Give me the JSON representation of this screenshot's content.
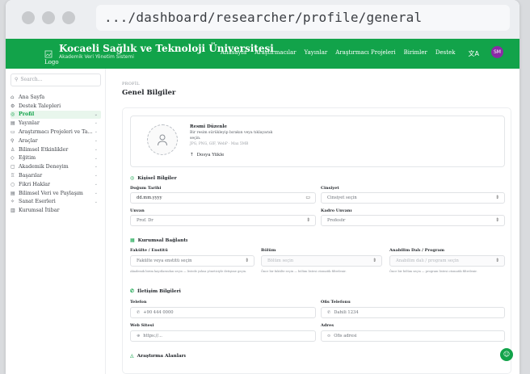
{
  "browser": {
    "url": ".../dashboard/researcher/profile/general"
  },
  "appbar": {
    "logo_alt": "Logo",
    "brand": "Kocaeli Sağlık ve Teknoloji Üniversitesi",
    "brand_sub": "Akademik Veri Yönetim Sistemi",
    "nav": [
      "Anasayfa",
      "Araştırmacılar",
      "Yayınlar",
      "Araştırmacı Projeleri",
      "Birimler",
      "Destek"
    ],
    "translate_icon": "文A",
    "avatar_initials": "SM",
    "brand_color": "#12a34a"
  },
  "sidebar": {
    "search_placeholder": "Search...",
    "items": [
      {
        "label": "Ana Sayfa",
        "icon": "⌂",
        "chevron": false,
        "active": false
      },
      {
        "label": "Destek Talepleri",
        "icon": "⚙",
        "chevron": false,
        "active": false
      },
      {
        "label": "Profil",
        "icon": "◎",
        "chevron": true,
        "active": true
      },
      {
        "label": "Yayınlar",
        "icon": "▤",
        "chevron": true,
        "active": false
      },
      {
        "label": "Araştırmacı Projeleri ve Ta...",
        "icon": "▭",
        "chevron": true,
        "active": false
      },
      {
        "label": "Araçlar",
        "icon": "⚲",
        "chevron": true,
        "active": false
      },
      {
        "label": "Bilimsel Etkinlikler",
        "icon": "♙",
        "chevron": true,
        "active": false
      },
      {
        "label": "Eğitim",
        "icon": "◇",
        "chevron": true,
        "active": false
      },
      {
        "label": "Akademik Deneyim",
        "icon": "▢",
        "chevron": true,
        "active": false
      },
      {
        "label": "Başarılar",
        "icon": "♖",
        "chevron": true,
        "active": false
      },
      {
        "label": "Fikri Haklar",
        "icon": "○",
        "chevron": true,
        "active": false
      },
      {
        "label": "Bilimsel Veri ve Paylaşım",
        "icon": "▤",
        "chevron": true,
        "active": false
      },
      {
        "label": "Sanat Eserleri",
        "icon": "✧",
        "chevron": true,
        "active": false
      },
      {
        "label": "Kurumsal İtibar",
        "icon": "▥",
        "chevron": false,
        "active": false
      }
    ]
  },
  "main": {
    "breadcrumb": "PROFİL",
    "title": "Genel Bilgiler",
    "photo": {
      "title": "Resmi Düzenle",
      "desc": "Bir resim sürükleyip bırakın veya tıklayarak seçin.",
      "hint": "JPG, PNG, GIF, WebP · Max 5MB",
      "upload_label": "Dosya Yükle"
    },
    "personal": {
      "heading": "Kişisel Bilgiler",
      "birth_label": "Doğum Tarihi",
      "birth_value": "dd.mm.yyyy",
      "gender_label": "Cinsiyet",
      "gender_value": "Cinsiyet seçin",
      "title_label": "Unvan",
      "title_value": "Prof. Dr",
      "staff_label": "Kadro Unvanı",
      "staff_value": "Profesör"
    },
    "institution": {
      "heading": "Kurumsal Bağlantı",
      "faculty_label": "Fakülte / Enstitü",
      "faculty_value": "Fakülte veya enstitü seçin",
      "faculty_help": "Akademik birim kayıtlarından seçin — listede yoksa yöneticiyle iletişime geçin.",
      "dept_label": "Bölüm",
      "dept_value": "Bölüm seçin",
      "dept_help": "Önce bir fakülte seçin — bölüm listesi otomatik filtrelenir.",
      "ad_label": "Anabilim Dalı / Program",
      "ad_value": "Anabilim dalı / program seçin",
      "ad_help": "Önce bir bölüm seçin — program listesi otomatik filtrelenir."
    },
    "contact": {
      "heading": "İletişim Bilgileri",
      "phone_label": "Telefon",
      "phone_value": "+90 444 0000",
      "office_label": "Ofis Telefonu",
      "office_value": "Dahili 1234",
      "web_label": "Web Sitesi",
      "web_value": "https://...",
      "addr_label": "Adres",
      "addr_value": "Ofis adresi"
    },
    "research": {
      "heading": "Araştırma Alanları"
    }
  }
}
